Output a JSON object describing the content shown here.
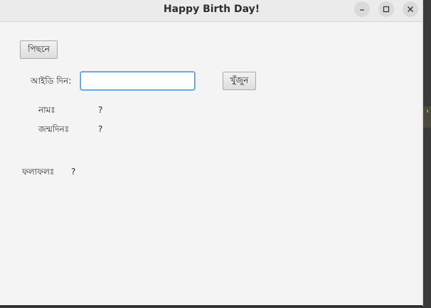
{
  "window": {
    "title": "Happy Birth Day!",
    "controls": {
      "minimize_icon": "minimize-icon",
      "maximize_icon": "maximize-icon",
      "close_icon": "close-icon"
    }
  },
  "form": {
    "back_button": "পিছনে",
    "id_label": "আইডি দিন:",
    "id_input": {
      "value": "",
      "placeholder": ""
    },
    "search_button": "খুঁজুন"
  },
  "details": {
    "name_label": "নামঃ",
    "name_value": "?",
    "dob_label": "জন্মদিনঃ",
    "dob_value": "?"
  },
  "result": {
    "label": "ফলাফলঃ",
    "value": "?"
  },
  "colors": {
    "input_focus": "#3d9be9",
    "window_bg": "#f4f4f4"
  }
}
